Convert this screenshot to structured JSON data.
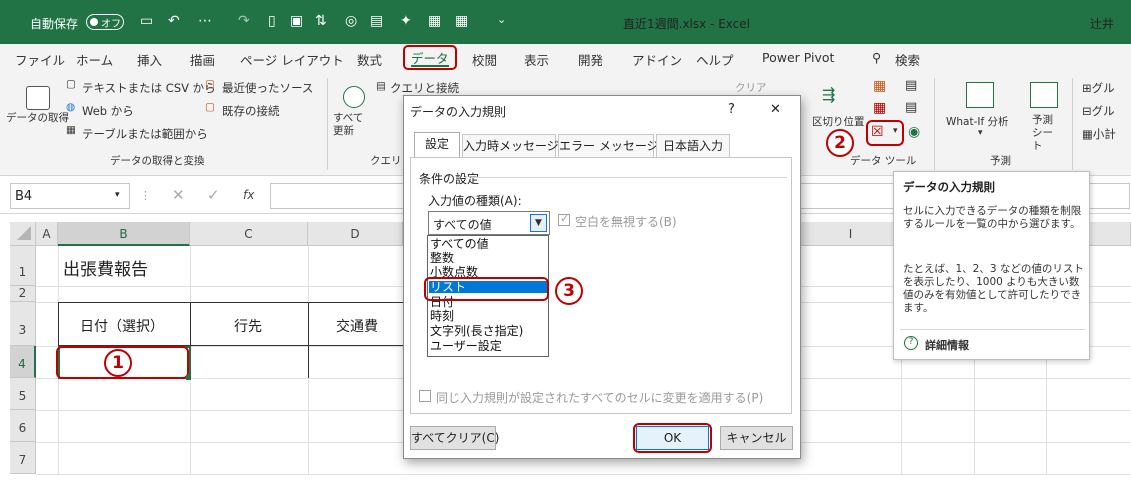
{
  "titlebar": {
    "autosave_label": "自動保存",
    "autosave_state": "オフ",
    "filename": "直近1週間.xlsx  -  Excel",
    "user": "辻井"
  },
  "menu": {
    "items": [
      "ファイル",
      "ホーム",
      "挿入",
      "描画",
      "ページ レイアウト",
      "数式",
      "データ",
      "校閲",
      "表示",
      "開発",
      "アドイン",
      "ヘルプ",
      "Power Pivot"
    ],
    "active": "データ",
    "search": "検索"
  },
  "ribbon": {
    "get_data": "データの取得",
    "text_csv": "テキストまたは CSV から",
    "web": "Web から",
    "table_range": "テーブルまたは範囲から",
    "recent_sources": "最近使ったソース",
    "existing_conn": "既存の接続",
    "group_get": "データの取得と変換",
    "refresh_all": "すべて更新",
    "queries_conn": "クエリと接続",
    "group_queries": "クエリと接",
    "clear": "クリア",
    "text_to_cols": "区切り位置",
    "group_datatools": "データ ツール",
    "what_if": "What-If 分析",
    "forecast_sheet": "予測シート",
    "group_forecast": "予測",
    "group_cut": "グル",
    "group_cut2": "グル",
    "subtotal_cut": "小計"
  },
  "formula_bar": {
    "name_box": "B4",
    "fx": "fx"
  },
  "sheet": {
    "columns": [
      "A",
      "B",
      "C",
      "D",
      "I"
    ],
    "rows": [
      "1",
      "2",
      "3",
      "4",
      "5",
      "6",
      "7"
    ],
    "title": "出張費報告",
    "headers": [
      "日付（選択）",
      "行先",
      "交通費"
    ]
  },
  "dialog": {
    "title": "データの入力規則",
    "help": "?",
    "close": "✕",
    "tabs": [
      "設定",
      "入力時メッセージ",
      "エラー メッセージ",
      "日本語入力"
    ],
    "section": "条件の設定",
    "type_label": "入力値の種類(A):",
    "selected_value": "すべての値",
    "ignore_blank": "空白を無視する(B)",
    "options": [
      "すべての値",
      "整数",
      "小数点数",
      "リスト",
      "日付",
      "時刻",
      "文字列(長さ指定)",
      "ユーザー設定"
    ],
    "apply_all": "同じ入力規則が設定されたすべてのセルに変更を適用する(P)",
    "clear_all": "すべてクリア(C)",
    "ok": "OK",
    "cancel": "キャンセル"
  },
  "tooltip": {
    "title": "データの入力規則",
    "body1": "セルに入力できるデータの種類を制限するルールを一覧の中から選びます。",
    "body2": "たとえば、1、2、3 などの値のリストを表示したり、1000 よりも大きい数値のみを有効値として許可したりできます。",
    "link": "詳細情報"
  },
  "callouts": [
    "1",
    "2",
    "3"
  ],
  "colors": {
    "excel_green": "#217346",
    "annotation_red": "#c00000",
    "selection_blue": "#0078d7"
  }
}
